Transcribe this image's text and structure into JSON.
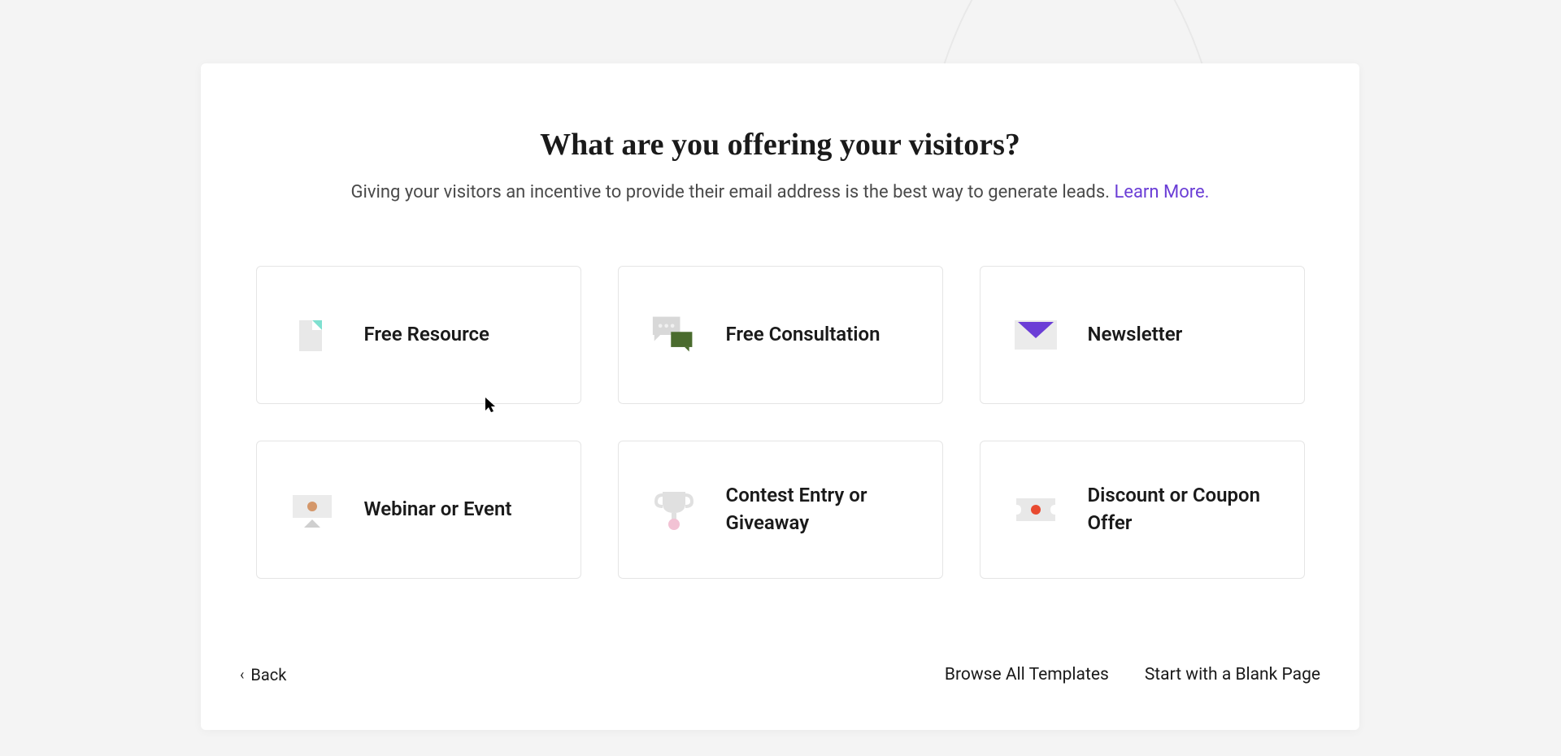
{
  "header": {
    "title": "What are you offering your visitors?",
    "subtitle": "Giving your visitors an incentive to provide their email address is the best way to generate leads. ",
    "learn_more": "Learn More."
  },
  "options": [
    {
      "label": "Free Resource",
      "icon": "document-icon"
    },
    {
      "label": "Free Consultation",
      "icon": "chat-icon"
    },
    {
      "label": "Newsletter",
      "icon": "envelope-icon"
    },
    {
      "label": "Webinar or Event",
      "icon": "presentation-icon"
    },
    {
      "label": "Contest Entry or Giveaway",
      "icon": "trophy-icon"
    },
    {
      "label": "Discount or Coupon Offer",
      "icon": "ticket-icon"
    }
  ],
  "footer": {
    "back": "Back",
    "browse": "Browse All Templates",
    "blank": "Start with a Blank Page"
  }
}
